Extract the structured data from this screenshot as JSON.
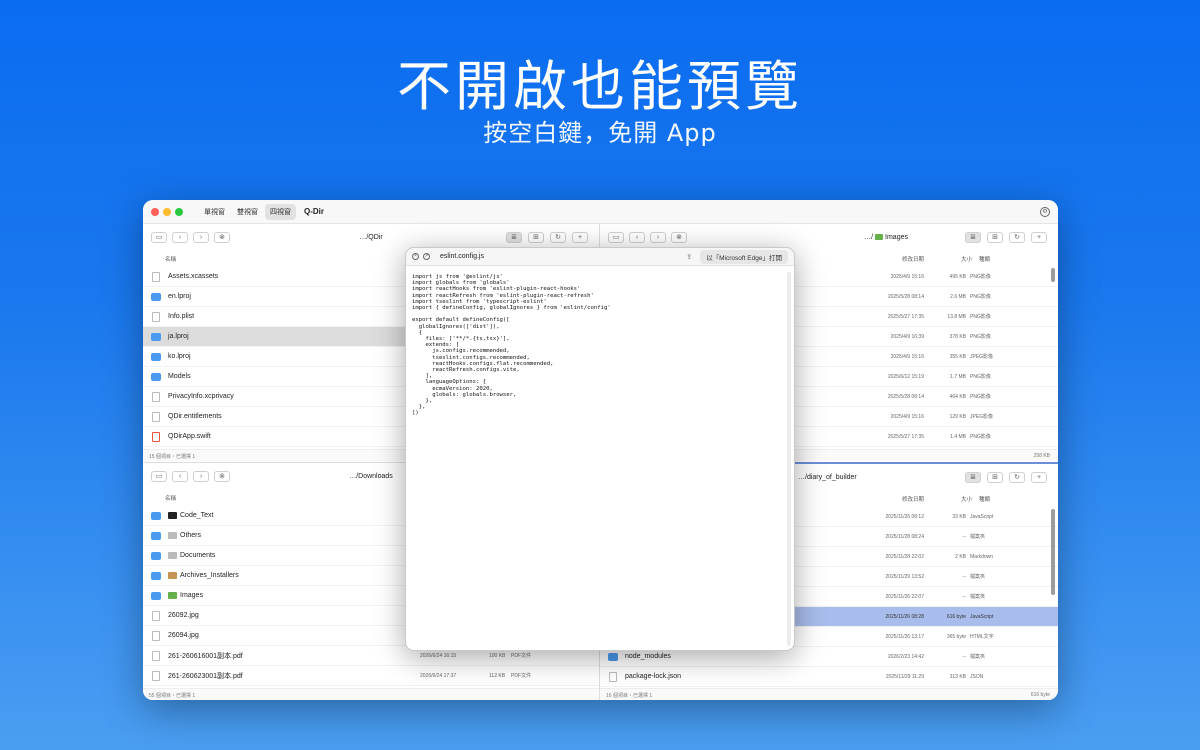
{
  "marketing": {
    "headline": "不開啟也能預覽",
    "subline": "按空白鍵，免開 App"
  },
  "window": {
    "view_modes": [
      "單視窗",
      "雙視窗",
      "四視窗"
    ],
    "active_view": "四視窗",
    "app_title": "Q-Dir"
  },
  "columns": {
    "name": "名稱",
    "date": "修改日期",
    "size": "大小",
    "kind": "種類"
  },
  "panes": {
    "top_left": {
      "path": "…/QDir",
      "status": "15 個項目・已選擇 1",
      "rows": [
        {
          "name": "Assets.xcassets",
          "icon": "file-icon"
        },
        {
          "name": "en.lproj",
          "icon": "folder-icon"
        },
        {
          "name": "Info.plist",
          "icon": "file-icon"
        },
        {
          "name": "ja.lproj",
          "icon": "folder-icon",
          "selected": true
        },
        {
          "name": "ko.lproj",
          "icon": "folder-icon"
        },
        {
          "name": "Models",
          "icon": "folder-icon"
        },
        {
          "name": "PrivacyInfo.xcprivacy",
          "icon": "file-icon"
        },
        {
          "name": "QDir.entitlements",
          "icon": "file-icon"
        },
        {
          "name": "QDirApp.swift",
          "icon": "swift-icon"
        }
      ]
    },
    "top_right": {
      "path": "…/",
      "path_tail": "Images",
      "status_size": "258 KB",
      "rows": [
        {
          "date": "2025/4/9 15:16",
          "size": "495 KB",
          "kind": "PNG影像"
        },
        {
          "date": "2025/5/28 08:14",
          "size": "2.6 MB",
          "kind": "PNG影像"
        },
        {
          "date": "2025/5/27 17:35",
          "size": "13.8 MB",
          "kind": "PNG影像"
        },
        {
          "date": "2025/4/9 16:39",
          "size": "378 KB",
          "kind": "PNG影像"
        },
        {
          "date": "2025/4/9 15:16",
          "size": "355 KB",
          "kind": "JPEG影像"
        },
        {
          "date": "2025/6/12 15:19",
          "size": "1.7 MB",
          "kind": "PNG影像"
        },
        {
          "date": "2025/5/28 08:14",
          "size": "464 KB",
          "kind": "PNG影像"
        },
        {
          "date": "2025/4/9 15:16",
          "size": "129 KB",
          "kind": "JPEG影像"
        },
        {
          "date": "2025/5/27 17:35",
          "size": "1.4 MB",
          "kind": "PNG影像"
        }
      ]
    },
    "bottom_left": {
      "path": "…/Downloads",
      "status": "55 個項目・已選擇 1",
      "rows": [
        {
          "name": "Code_Text",
          "sub": "term"
        },
        {
          "name": "Others",
          "sub": "doc"
        },
        {
          "name": "Documents",
          "sub": "doc"
        },
        {
          "name": "Archives_Installers",
          "sub": "box"
        },
        {
          "name": "Images",
          "sub": "pic"
        },
        {
          "name": "26092.jpg",
          "icon": "file-icon"
        },
        {
          "name": "26094.jpg",
          "icon": "file-icon"
        },
        {
          "name": "261-260616001副本.pdf",
          "icon": "file-icon",
          "date": "2026/6/24 16:15",
          "size": "100 KB",
          "kind": "PDF文件"
        },
        {
          "name": "261-260623001副本.pdf",
          "icon": "file-icon",
          "date": "2026/6/24 17:37",
          "size": "112 KB",
          "kind": "PDF文件"
        }
      ]
    },
    "bottom_right": {
      "path": "…/diary_of_builder",
      "status": "16 個項目・已選擇 1",
      "status_size": "616 byte",
      "rows": [
        {
          "name": "",
          "date": "2025/11/26 08:12",
          "size": "33 KB",
          "kind": "JavaScript"
        },
        {
          "name": "",
          "date": "2025/11/28 08:24",
          "size": "--",
          "kind": "檔案夾"
        },
        {
          "name": "",
          "date": "2025/11/28 22:02",
          "size": "2 KB",
          "kind": "Markdown"
        },
        {
          "name": "",
          "date": "2025/11/29 13:52",
          "size": "--",
          "kind": "檔案夾"
        },
        {
          "name": "",
          "date": "2025/11/26 22:07",
          "size": "--",
          "kind": "檔案夾"
        },
        {
          "name": "",
          "date": "2025/11/26 08:28",
          "size": "616 byte",
          "kind": "JavaScript",
          "selected": true
        },
        {
          "name": "",
          "date": "2025/11/26 13:17",
          "size": "365 byte",
          "kind": "HTML文字"
        },
        {
          "name": "node_modules",
          "date": "2026/2/23 14:42",
          "size": "--",
          "kind": "檔案夾",
          "icon": "folder-icon"
        },
        {
          "name": "package-lock.json",
          "date": "2025/11/29 11:29",
          "size": "313 KB",
          "kind": "JSON",
          "icon": "file-icon"
        }
      ]
    }
  },
  "preview": {
    "filename": "eslint.config.js",
    "open_with": "以「Microsoft Edge」打開",
    "code": "import js from '@eslint/js'\nimport globals from 'globals'\nimport reactHooks from 'eslint-plugin-react-hooks'\nimport reactRefresh from 'eslint-plugin-react-refresh'\nimport tseslint from 'typescript-eslint'\nimport { defineConfig, globalIgnores } from 'eslint/config'\n\nexport default defineConfig([\n  globalIgnores(['dist']),\n  {\n    files: ['**/*.{ts,tsx}'],\n    extends: [\n      js.configs.recommended,\n      tseslint.configs.recommended,\n      reactHooks.configs.flat.recommended,\n      reactRefresh.configs.vite,\n    ],\n    languageOptions: {\n      ecmaVersion: 2020,\n      globals: globals.browser,\n    },\n  },\n])"
  }
}
